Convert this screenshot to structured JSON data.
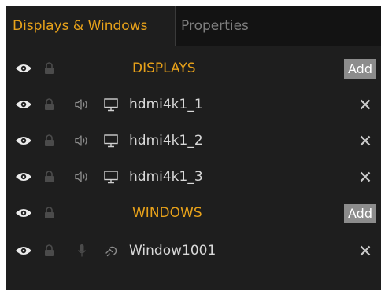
{
  "tabs": [
    {
      "label": "Displays & Windows",
      "active": true
    },
    {
      "label": "Properties",
      "active": false
    }
  ],
  "displays_section": {
    "title": "DISPLAYS",
    "add_label": "Add"
  },
  "displays": [
    {
      "name": "hdmi4k1_1"
    },
    {
      "name": "hdmi4k1_2"
    },
    {
      "name": "hdmi4k1_3"
    }
  ],
  "windows_section": {
    "title": "WINDOWS",
    "add_label": "Add"
  },
  "windows": [
    {
      "name": "Window1001"
    }
  ],
  "icons": {
    "visibility": "eye-icon",
    "lock": "lock-icon",
    "display_audio": "speaker-icon",
    "display_type": "monitor-icon",
    "window_audio": "microphone-icon",
    "window_type": "window-source-icon",
    "remove": "close-icon"
  },
  "colors": {
    "background": "#1e1e1e",
    "tab_bar": "#131313",
    "accent": "#e8a21a",
    "text": "#d9d9d9",
    "muted_text": "#7f7f7f",
    "button": "#8c8c8c"
  }
}
